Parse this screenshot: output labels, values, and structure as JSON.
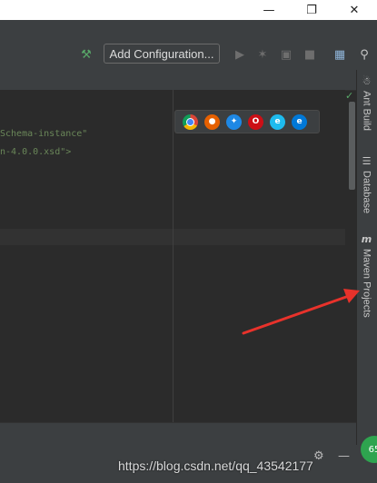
{
  "toolbar": {
    "add_configuration_label": "Add Configuration...",
    "icons": [
      "build-hammer-icon",
      "run-icon",
      "debug-icon",
      "coverage-icon",
      "stop-icon",
      "project-structure-icon",
      "search-icon"
    ]
  },
  "editor": {
    "code_lines": [
      "Schema-instance\"",
      "n-4.0.0.xsd\">"
    ]
  },
  "browsers": [
    "chrome",
    "firefox",
    "safari",
    "opera",
    "internet-explorer",
    "edge"
  ],
  "right_tools": {
    "ant_build": "Ant Build",
    "database": "Database",
    "maven_projects": "Maven Projects",
    "maven_icon": "m"
  },
  "status": {
    "badge": "65",
    "watermark": "https://blog.csdn.net/qq_43542177"
  },
  "colors": {
    "arrow": "#e8322b",
    "badge": "#2ea44f",
    "code_string": "#6a8759"
  }
}
